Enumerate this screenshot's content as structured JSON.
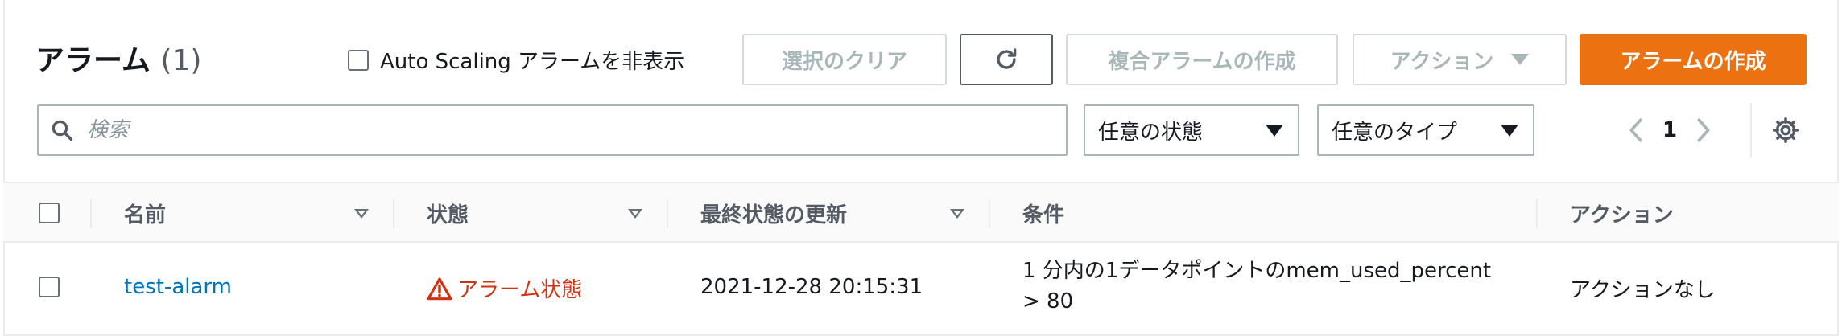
{
  "header": {
    "title": "アラーム",
    "count": "(1)",
    "hide_autoscaling_label": "Auto Scaling アラームを非表示"
  },
  "toolbar": {
    "clear_selection": "選択のクリア",
    "refresh_icon": "refresh-icon",
    "create_composite": "複合アラームの作成",
    "actions": "アクション",
    "create_alarm": "アラームの作成"
  },
  "filters": {
    "search_placeholder": "検索",
    "state_filter": "任意の状態",
    "type_filter": "任意のタイプ"
  },
  "pagination": {
    "page": "1"
  },
  "table": {
    "columns": [
      "名前",
      "状態",
      "最終状態の更新",
      "条件",
      "アクション"
    ],
    "rows": [
      {
        "name": "test-alarm",
        "state": "アラーム状態",
        "last_update": "2021-12-28 20:15:31",
        "condition_line1": "1 分内の1データポイントのmem_used_percent",
        "condition_line2": "> 80",
        "actions": "アクションなし"
      }
    ]
  },
  "colors": {
    "primary": "#ec7211",
    "link": "#0073bb",
    "alarm": "#d13212",
    "disabled": "#aab7b8"
  }
}
